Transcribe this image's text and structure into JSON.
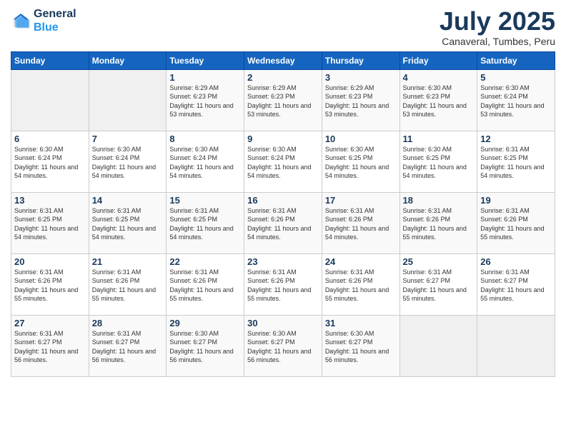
{
  "logo": {
    "line1": "General",
    "line2": "Blue"
  },
  "title": "July 2025",
  "subtitle": "Canaveral, Tumbes, Peru",
  "headers": [
    "Sunday",
    "Monday",
    "Tuesday",
    "Wednesday",
    "Thursday",
    "Friday",
    "Saturday"
  ],
  "weeks": [
    [
      {
        "day": "",
        "info": ""
      },
      {
        "day": "",
        "info": ""
      },
      {
        "day": "1",
        "info": "Sunrise: 6:29 AM\nSunset: 6:23 PM\nDaylight: 11 hours and 53 minutes."
      },
      {
        "day": "2",
        "info": "Sunrise: 6:29 AM\nSunset: 6:23 PM\nDaylight: 11 hours and 53 minutes."
      },
      {
        "day": "3",
        "info": "Sunrise: 6:29 AM\nSunset: 6:23 PM\nDaylight: 11 hours and 53 minutes."
      },
      {
        "day": "4",
        "info": "Sunrise: 6:30 AM\nSunset: 6:23 PM\nDaylight: 11 hours and 53 minutes."
      },
      {
        "day": "5",
        "info": "Sunrise: 6:30 AM\nSunset: 6:24 PM\nDaylight: 11 hours and 53 minutes."
      }
    ],
    [
      {
        "day": "6",
        "info": "Sunrise: 6:30 AM\nSunset: 6:24 PM\nDaylight: 11 hours and 54 minutes."
      },
      {
        "day": "7",
        "info": "Sunrise: 6:30 AM\nSunset: 6:24 PM\nDaylight: 11 hours and 54 minutes."
      },
      {
        "day": "8",
        "info": "Sunrise: 6:30 AM\nSunset: 6:24 PM\nDaylight: 11 hours and 54 minutes."
      },
      {
        "day": "9",
        "info": "Sunrise: 6:30 AM\nSunset: 6:24 PM\nDaylight: 11 hours and 54 minutes."
      },
      {
        "day": "10",
        "info": "Sunrise: 6:30 AM\nSunset: 6:25 PM\nDaylight: 11 hours and 54 minutes."
      },
      {
        "day": "11",
        "info": "Sunrise: 6:30 AM\nSunset: 6:25 PM\nDaylight: 11 hours and 54 minutes."
      },
      {
        "day": "12",
        "info": "Sunrise: 6:31 AM\nSunset: 6:25 PM\nDaylight: 11 hours and 54 minutes."
      }
    ],
    [
      {
        "day": "13",
        "info": "Sunrise: 6:31 AM\nSunset: 6:25 PM\nDaylight: 11 hours and 54 minutes."
      },
      {
        "day": "14",
        "info": "Sunrise: 6:31 AM\nSunset: 6:25 PM\nDaylight: 11 hours and 54 minutes."
      },
      {
        "day": "15",
        "info": "Sunrise: 6:31 AM\nSunset: 6:25 PM\nDaylight: 11 hours and 54 minutes."
      },
      {
        "day": "16",
        "info": "Sunrise: 6:31 AM\nSunset: 6:26 PM\nDaylight: 11 hours and 54 minutes."
      },
      {
        "day": "17",
        "info": "Sunrise: 6:31 AM\nSunset: 6:26 PM\nDaylight: 11 hours and 54 minutes."
      },
      {
        "day": "18",
        "info": "Sunrise: 6:31 AM\nSunset: 6:26 PM\nDaylight: 11 hours and 55 minutes."
      },
      {
        "day": "19",
        "info": "Sunrise: 6:31 AM\nSunset: 6:26 PM\nDaylight: 11 hours and 55 minutes."
      }
    ],
    [
      {
        "day": "20",
        "info": "Sunrise: 6:31 AM\nSunset: 6:26 PM\nDaylight: 11 hours and 55 minutes."
      },
      {
        "day": "21",
        "info": "Sunrise: 6:31 AM\nSunset: 6:26 PM\nDaylight: 11 hours and 55 minutes."
      },
      {
        "day": "22",
        "info": "Sunrise: 6:31 AM\nSunset: 6:26 PM\nDaylight: 11 hours and 55 minutes."
      },
      {
        "day": "23",
        "info": "Sunrise: 6:31 AM\nSunset: 6:26 PM\nDaylight: 11 hours and 55 minutes."
      },
      {
        "day": "24",
        "info": "Sunrise: 6:31 AM\nSunset: 6:26 PM\nDaylight: 11 hours and 55 minutes."
      },
      {
        "day": "25",
        "info": "Sunrise: 6:31 AM\nSunset: 6:27 PM\nDaylight: 11 hours and 55 minutes."
      },
      {
        "day": "26",
        "info": "Sunrise: 6:31 AM\nSunset: 6:27 PM\nDaylight: 11 hours and 55 minutes."
      }
    ],
    [
      {
        "day": "27",
        "info": "Sunrise: 6:31 AM\nSunset: 6:27 PM\nDaylight: 11 hours and 56 minutes."
      },
      {
        "day": "28",
        "info": "Sunrise: 6:31 AM\nSunset: 6:27 PM\nDaylight: 11 hours and 56 minutes."
      },
      {
        "day": "29",
        "info": "Sunrise: 6:30 AM\nSunset: 6:27 PM\nDaylight: 11 hours and 56 minutes."
      },
      {
        "day": "30",
        "info": "Sunrise: 6:30 AM\nSunset: 6:27 PM\nDaylight: 11 hours and 56 minutes."
      },
      {
        "day": "31",
        "info": "Sunrise: 6:30 AM\nSunset: 6:27 PM\nDaylight: 11 hours and 56 minutes."
      },
      {
        "day": "",
        "info": ""
      },
      {
        "day": "",
        "info": ""
      }
    ]
  ]
}
